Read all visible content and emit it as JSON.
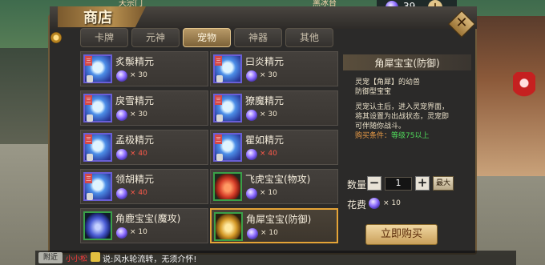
{
  "top": {
    "gem_count": "39",
    "left_label": "天宗门",
    "right_label": "黑冰台"
  },
  "shop": {
    "title": "商店",
    "tabs": [
      "卡牌",
      "元神",
      "宠物",
      "神器",
      "其他"
    ],
    "active_tab": "宠物"
  },
  "items": [
    {
      "name": "炙鬃精元",
      "price": "× 30",
      "price_color": "white"
    },
    {
      "name": "曰炎精元",
      "price": "× 30",
      "price_color": "white"
    },
    {
      "name": "戾雪精元",
      "price": "× 30",
      "price_color": "white"
    },
    {
      "name": "獠魔精元",
      "price": "× 30",
      "price_color": "white"
    },
    {
      "name": "孟极精元",
      "price": "× 40",
      "price_color": "red"
    },
    {
      "name": "瞿如精元",
      "price": "× 40",
      "price_color": "red"
    },
    {
      "name": "领胡精元",
      "price": "× 40",
      "price_color": "red"
    },
    {
      "name": "飞虎宝宝(物攻)",
      "price": "× 10",
      "price_color": "white"
    },
    {
      "name": "角鹿宝宝(魔攻)",
      "price": "× 10",
      "price_color": "white"
    },
    {
      "name": "角犀宝宝(防御)",
      "price": "× 10",
      "price_color": "white"
    }
  ],
  "detail": {
    "title": "角犀宝宝(防御)",
    "lines": [
      "灵宠【角犀】的幼兽",
      "防御型宝宝",
      "灵宠认主后，进入灵宠界面，",
      "将其设置为出战状态，灵宠即",
      "可伴随你战斗。"
    ],
    "condition_label": "购买条件：",
    "condition_value": "等级75以上",
    "qty_label": "数量",
    "qty_value": "1",
    "qty_minus": "−",
    "qty_plus": "+",
    "max_label": "最大",
    "cost_label": "花费",
    "cost_value": "× 10",
    "buy_label": "立即购买"
  },
  "chat": {
    "channel": "附近",
    "name": "小小松",
    "text": "说:风水轮流转，无须介怀!"
  },
  "colors": {
    "accent": "#e5a437",
    "price_red": "#ff5a4a",
    "condition_green": "#4fd85a"
  }
}
